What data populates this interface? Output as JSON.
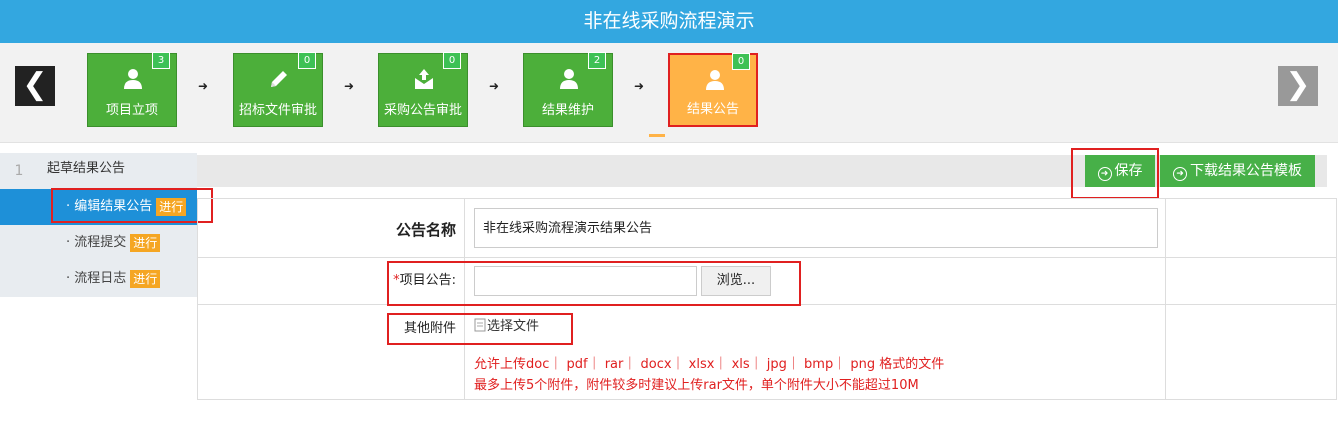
{
  "title": "非在线采购流程演示",
  "steps": [
    {
      "label": "项目立项",
      "count": "3",
      "icon": "user-icon"
    },
    {
      "label": "招标文件审批",
      "count": "0",
      "icon": "pencil-icon"
    },
    {
      "label": "采购公告审批",
      "count": "0",
      "icon": "mail-upload-icon"
    },
    {
      "label": "结果维护",
      "count": "2",
      "icon": "user-icon"
    },
    {
      "label": "结果公告",
      "count": "0",
      "icon": "user-icon",
      "active": true
    }
  ],
  "nav": {
    "prev": "❮",
    "next": "❯"
  },
  "sidebar": {
    "step_number": "1",
    "title": "起草结果公告",
    "items": [
      {
        "label": "· 编辑结果公告",
        "tag": "进行",
        "selected": true
      },
      {
        "label": "· 流程提交",
        "tag": "进行"
      },
      {
        "label": "· 流程日志",
        "tag": "进行"
      }
    ]
  },
  "toolbar": {
    "save_label": "保存",
    "download_label": "下载结果公告模板"
  },
  "form": {
    "name_label": "公告名称",
    "name_value": "非在线采购流程演示结果公告",
    "project_notice_required": "*",
    "project_notice_label": "项目公告:",
    "browse_label": "浏览...",
    "attachments_label": "其他附件",
    "choose_file_label": "选择文件",
    "hint_line1": "允许上传doc｜ pdf｜ rar｜ docx｜ xlsx｜ xls｜ jpg｜ bmp｜ png 格式的文件",
    "hint_line2": "最多上传5个附件，附件较多时建议上传rar文件，单个附件大小不能超过10M"
  },
  "colors": {
    "header": "#33a7e0",
    "step_green": "#4caf3a",
    "step_active": "#ffb347",
    "highlight_red": "#e02020",
    "sidebar_selected": "#1e90d8"
  }
}
